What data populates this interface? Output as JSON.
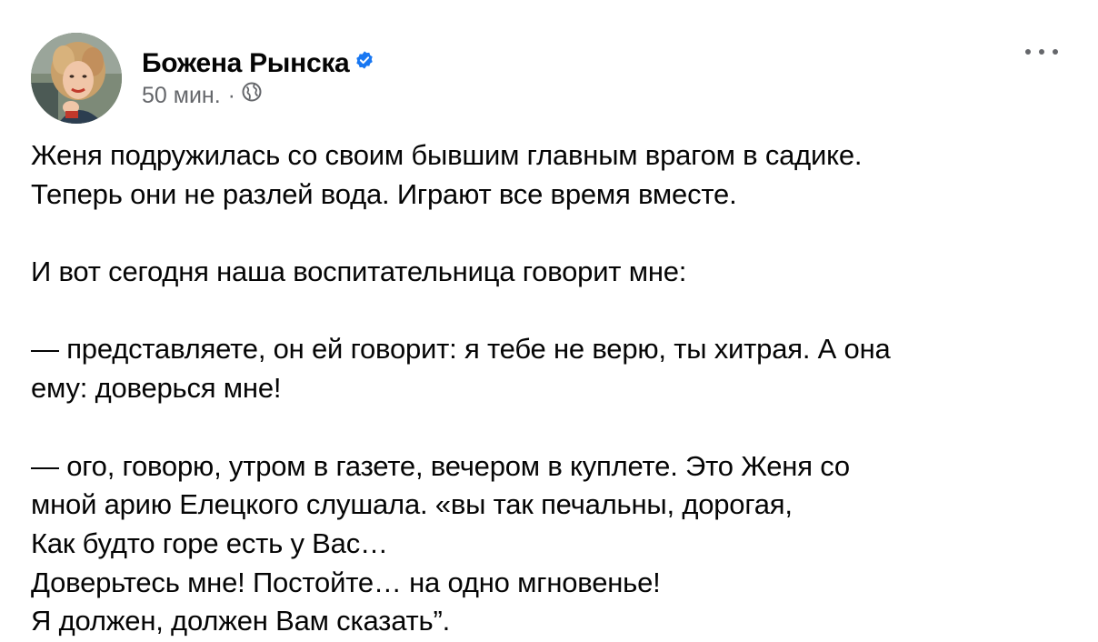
{
  "post": {
    "author_name": "Божена Рынска",
    "timestamp": "50 мин.",
    "separator": "·",
    "icons": {
      "verified": "verified-badge-icon",
      "audience": "globe-icon",
      "more": "more-options-icon"
    },
    "colors": {
      "verified": "#1877f2",
      "meta_text": "#65676b",
      "text": "#050505"
    },
    "body_lines": [
      "Женя подружилась со своим бывшим главным врагом в садике.",
      "Теперь они не разлей вода. Играют все время вместе.",
      "",
      "И вот сегодня наша воспитательница говорит мне:",
      "",
      "— представляете, он ей говорит: я тебе не верю, ты хитрая. А она",
      "ему: доверься мне!",
      "",
      "— ого, говорю, утром в газете, вечером в куплете. Это Женя со",
      "мной арию Елецкого слушала. «вы так печальны, дорогая,",
      "Как будто горе есть у Вас…",
      "Доверьтесь мне! Постойте… на одно мгновенье!",
      "Я должен, должен Вам сказать”."
    ]
  }
}
